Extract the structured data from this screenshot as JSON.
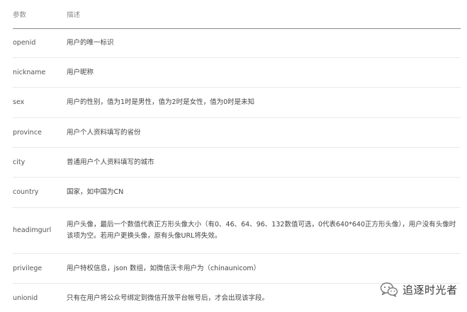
{
  "table": {
    "headers": [
      "参数",
      "描述"
    ],
    "rows": [
      {
        "name": "openid",
        "desc": "用户的唯一标识"
      },
      {
        "name": "nickname",
        "desc": "用户昵称"
      },
      {
        "name": "sex",
        "desc": "用户的性别，值为1时是男性，值为2时是女性，值为0时是未知"
      },
      {
        "name": "province",
        "desc": "用户个人资料填写的省份"
      },
      {
        "name": "city",
        "desc": "普通用户个人资料填写的城市"
      },
      {
        "name": "country",
        "desc": "国家，如中国为CN"
      },
      {
        "name": "headimgurl",
        "desc": "用户头像，最后一个数值代表正方形头像大小（有0、46、64、96、132数值可选，0代表640*640正方形头像），用户没有头像时该项为空。若用户更换头像，原有头像URL将失效。"
      },
      {
        "name": "privilege",
        "desc": "用户特权信息，json 数组，如微信沃卡用户为（chinaunicom）"
      },
      {
        "name": "unionid",
        "desc": "只有在用户将公众号绑定到微信开放平台帐号后，才会出现该字段。"
      }
    ]
  },
  "watermark": {
    "icon": "wechat-icon",
    "text": "追逐时光者"
  }
}
